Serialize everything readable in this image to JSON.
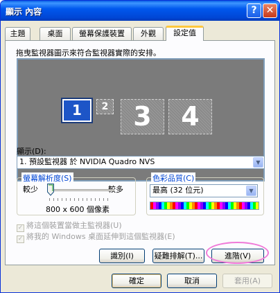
{
  "window": {
    "title": "顯示 內容",
    "help_glyph": "?",
    "close_glyph": "✕"
  },
  "tabs": [
    {
      "label": "主題"
    },
    {
      "label": "桌面"
    },
    {
      "label": "螢幕保護裝置"
    },
    {
      "label": "外觀"
    },
    {
      "label": "設定值",
      "active": true
    }
  ],
  "settings": {
    "instruction": "拖曳監視器圖示來符合監視器實際的安排。",
    "monitors": [
      "1",
      "2",
      "3",
      "4"
    ],
    "display_label": "顯示(D):",
    "display_value": "1. 預設監視器 於 NVIDIA Quadro NVS",
    "resolution": {
      "title": "螢幕解析度(S)",
      "less": "較少",
      "more": "較多",
      "value": "800 x 600 個像素",
      "slider_level": 0
    },
    "color_quality": {
      "title": "色彩品質(C)",
      "value": "最高 (32 位元)"
    },
    "checkbox_primary": "將這個裝置當做主監視器(U)",
    "checkbox_extend": "將我的 Windows 桌面延伸到這個監視器(E)",
    "identify_button": "識別(I)",
    "troubleshoot_button": "疑難排解(T)...",
    "advanced_button": "進階(V)"
  },
  "footer": {
    "ok": "確定",
    "cancel": "取消",
    "apply": "套用(A)"
  },
  "colors": {
    "titlebar": "#0058ee",
    "selected_monitor": "#1d55c7",
    "active_tab_accent": "#ffc83c",
    "annotation_circle": "#f07ad8"
  }
}
